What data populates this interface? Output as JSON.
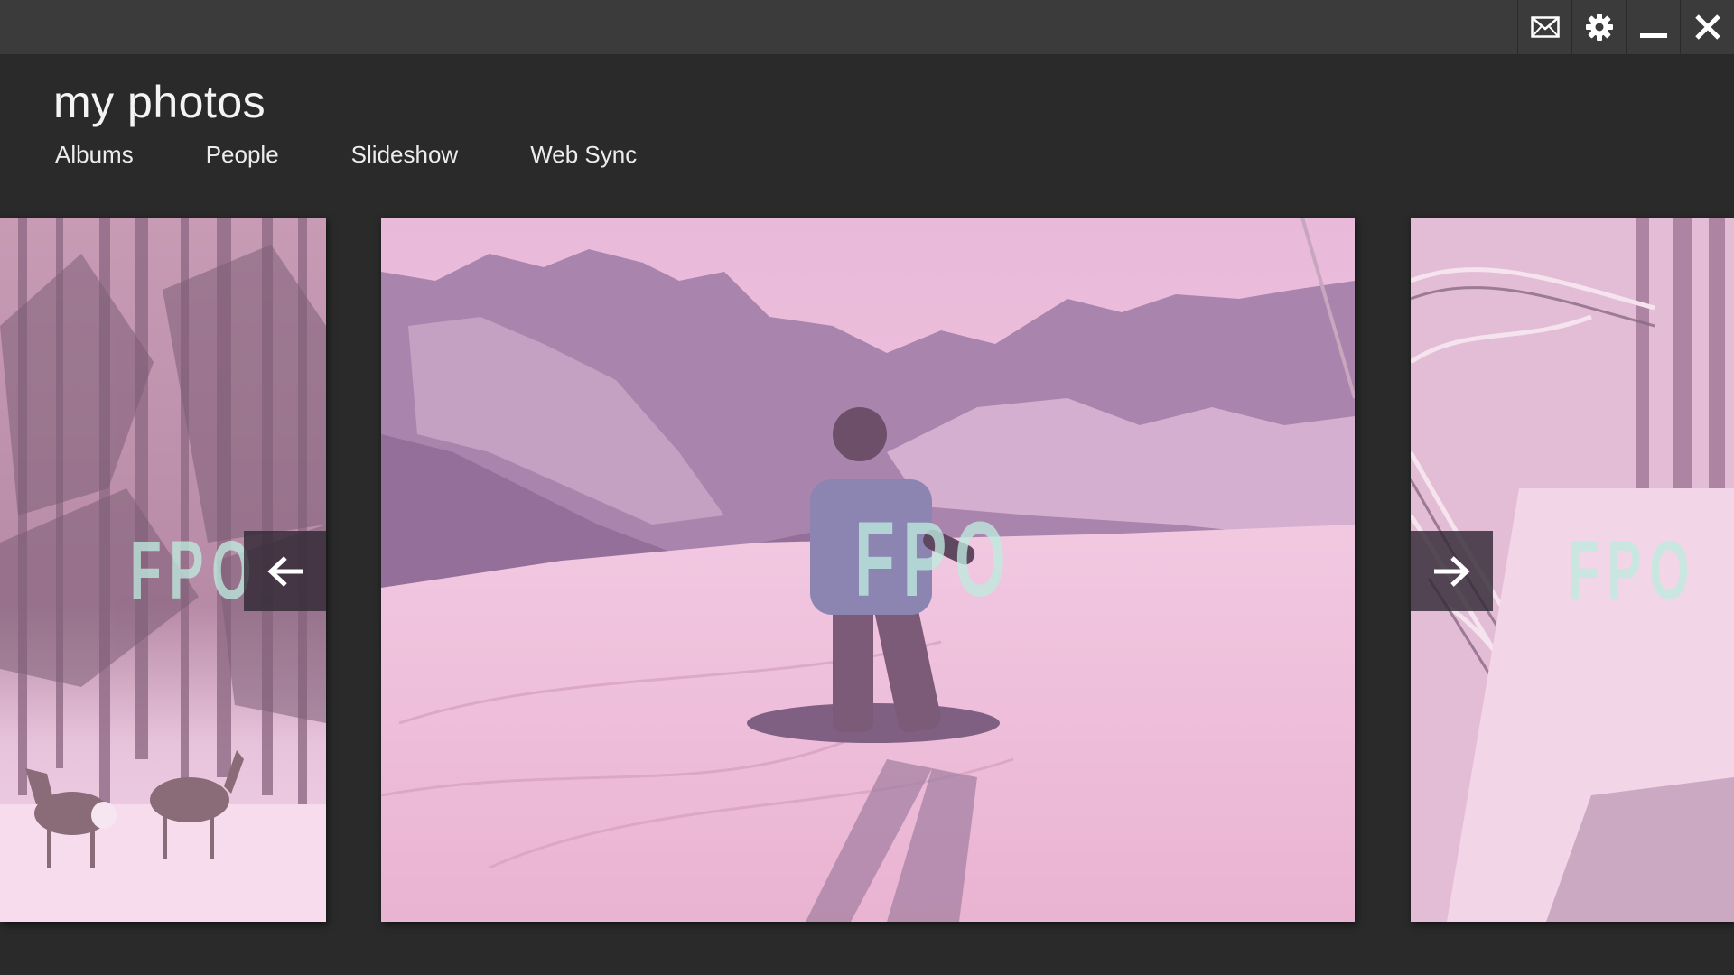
{
  "app": {
    "title": "my photos"
  },
  "nav": {
    "items": [
      {
        "label": "Albums"
      },
      {
        "label": "People"
      },
      {
        "label": "Slideshow"
      },
      {
        "label": "Web Sync"
      }
    ]
  },
  "window_controls": {
    "icons": [
      "mail-icon",
      "gear-icon",
      "minimize-icon",
      "close-icon"
    ]
  },
  "gallery": {
    "placeholder_text": "FPO",
    "photos": [
      {
        "position": "previous",
        "subject": "deer in snowy forest"
      },
      {
        "position": "current",
        "subject": "snowboarder on mountain slope"
      },
      {
        "position": "next",
        "subject": "snow-covered forest path"
      }
    ],
    "prev_icon": "arrow-left-icon",
    "next_icon": "arrow-right-icon"
  },
  "colors": {
    "titlebar": "#3b3b3b",
    "background": "#2a2a2a",
    "photo_tint": "#d9a3c7",
    "fpo_text": "#bfeade"
  }
}
